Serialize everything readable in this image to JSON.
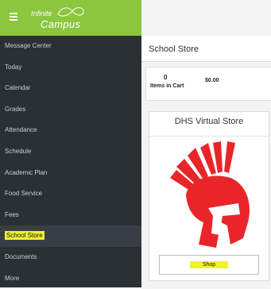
{
  "app": {
    "logo_line1": "Infinite",
    "logo_line2": "Campus"
  },
  "sidebar": {
    "items": [
      {
        "label": "Message Center"
      },
      {
        "label": "Today"
      },
      {
        "label": "Calendar"
      },
      {
        "label": "Grades"
      },
      {
        "label": "Attendance"
      },
      {
        "label": "Schedule"
      },
      {
        "label": "Academic Plan"
      },
      {
        "label": "Food Service"
      },
      {
        "label": "Fees"
      },
      {
        "label": "School Store",
        "active": true
      },
      {
        "label": "Documents"
      },
      {
        "label": "More"
      }
    ]
  },
  "main": {
    "title": "School Store",
    "cart": {
      "count": "0",
      "items_label": "Items in Cart",
      "total": "$0.00"
    },
    "store": {
      "name": "DHS Virtual Store",
      "shop_label": "Shop"
    }
  },
  "colors": {
    "topbar": "#8cc63f",
    "sidebar": "#2b3035",
    "highlight": "#f1f233",
    "mascot": "#e8262a"
  },
  "icons": {
    "menu": "hamburger-icon",
    "mascot": "spartan-helmet-logo"
  }
}
